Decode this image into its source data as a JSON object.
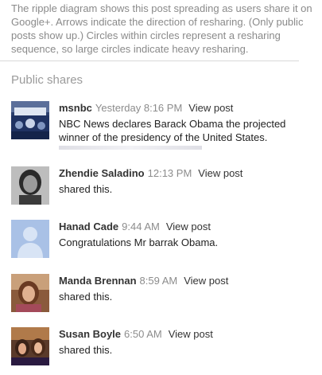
{
  "intro_text": "The ripple diagram shows this post spreading as users share it on Google+. Arrows indicate the direction of resharing. (Only public posts show up.) Circles within circles represent a resharing sequence, so large circles indicate heavy resharing.",
  "section_title": "Public shares",
  "shares": [
    {
      "author": "msnbc",
      "time": "Yesterday 8:16 PM",
      "view_label": "View post",
      "text": "NBC News declares Barack Obama the projected winner of the presidency of the United States."
    },
    {
      "author": "Zhendie Saladino",
      "time": "12:13 PM",
      "view_label": "View post",
      "text": "shared this."
    },
    {
      "author": "Hanad Cade",
      "time": "9:44 AM",
      "view_label": "View post",
      "text": "Congratulations Mr barrak Obama."
    },
    {
      "author": "Manda Brennan",
      "time": "8:59 AM",
      "view_label": "View post",
      "text": "shared this."
    },
    {
      "author": "Susan Boyle",
      "time": "6:50 AM",
      "view_label": "View post",
      "text": "shared this."
    }
  ]
}
